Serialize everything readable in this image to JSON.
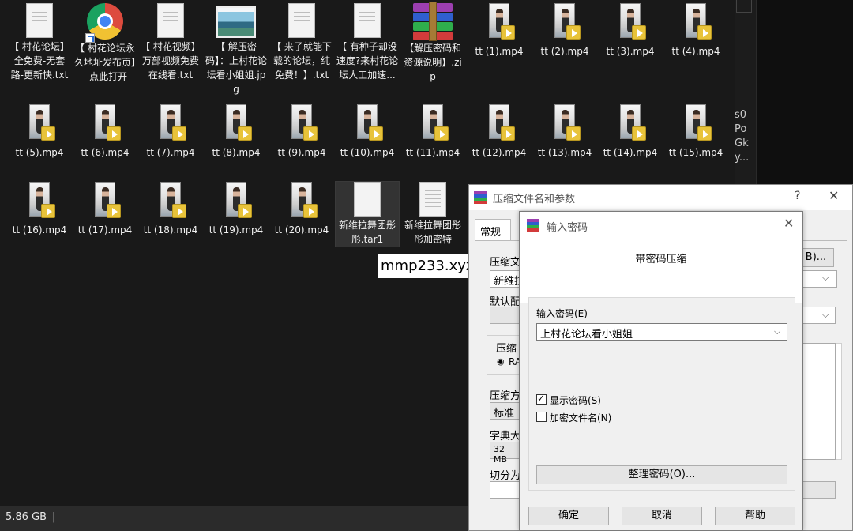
{
  "explorer": {
    "files": [
      {
        "type": "txt",
        "label": "【 村花论坛】全免费-无套路-更新快.txt"
      },
      {
        "type": "chrome",
        "label": "【 村花论坛永久地址发布页】- 点此打开"
      },
      {
        "type": "txt",
        "label": "【 村花视频】万部视频免费在线看.txt"
      },
      {
        "type": "jpg",
        "label": "【 解压密码】：上村花论坛看小姐姐.jpg"
      },
      {
        "type": "txt",
        "label": "【 来了就能下载的论坛，纯免费！】.txt"
      },
      {
        "type": "txt",
        "label": "【 有种子却没速度?来村花论坛人工加速..."
      },
      {
        "type": "zip",
        "label": "【解压密码和资源说明】.zip"
      },
      {
        "type": "video",
        "label": "tt (1).mp4"
      },
      {
        "type": "video",
        "label": "tt (2).mp4"
      },
      {
        "type": "video",
        "label": "tt (3).mp4"
      },
      {
        "type": "video",
        "label": "tt (4).mp4"
      },
      {
        "type": "video",
        "label": "tt (5).mp4"
      },
      {
        "type": "video",
        "label": "tt (6).mp4"
      },
      {
        "type": "video",
        "label": "tt (7).mp4"
      },
      {
        "type": "video",
        "label": "tt (8).mp4"
      },
      {
        "type": "video",
        "label": "tt (9).mp4"
      },
      {
        "type": "video",
        "label": "tt (10).mp4"
      },
      {
        "type": "video",
        "label": "tt (11).mp4"
      },
      {
        "type": "video",
        "label": "tt (12).mp4"
      },
      {
        "type": "video",
        "label": "tt (13).mp4"
      },
      {
        "type": "video",
        "label": "tt (14).mp4"
      },
      {
        "type": "video",
        "label": "tt (15).mp4"
      },
      {
        "type": "video",
        "label": "tt (16).mp4"
      },
      {
        "type": "video",
        "label": "tt (17).mp4"
      },
      {
        "type": "video",
        "label": "tt (18).mp4"
      },
      {
        "type": "video",
        "label": "tt (19).mp4"
      },
      {
        "type": "video",
        "label": "tt (20).mp4"
      },
      {
        "type": "blank",
        "label": "新维拉舞团彤彤.tar1"
      },
      {
        "type": "txt",
        "label": "新维拉舞团彤彤加密特"
      }
    ],
    "right_strip_text": [
      "s0",
      "Po",
      "Gk",
      "y..."
    ]
  },
  "status": {
    "size": "5.86 GB",
    "separator": "|"
  },
  "watermark": "mmp233.xyz",
  "archive_dialog": {
    "title": "压缩文件名和参数",
    "help": "?",
    "close": "✕",
    "tab_general": "常规",
    "archive_name_label": "压缩文",
    "archive_name_value": "新维拉",
    "browse_button": "B)...",
    "default_profile_label": "默认配",
    "format_label": "压缩",
    "format_option": "RA",
    "method_label": "压缩方",
    "method_value": "标准",
    "dict_label": "字典大",
    "dict_value": "32 MB",
    "split_label": "切分为"
  },
  "password_dialog": {
    "title": "输入密码",
    "close": "✕",
    "heading": "带密码压缩",
    "password_label": "输入密码(E)",
    "password_value": "上村花论坛看小姐姐",
    "show_password_label": "显示密码(S)",
    "show_password_checked": true,
    "encrypt_names_label": "加密文件名(N)",
    "encrypt_names_checked": false,
    "organize_button": "整理密码(O)...",
    "ok_button": "确定",
    "cancel_button": "取消",
    "help_button": "帮助"
  },
  "colors": {
    "winrar_purple": "#9c3fb0",
    "winrar_blue": "#2f5fcf",
    "winrar_green": "#2fae4c",
    "winrar_red": "#d23b3b"
  }
}
